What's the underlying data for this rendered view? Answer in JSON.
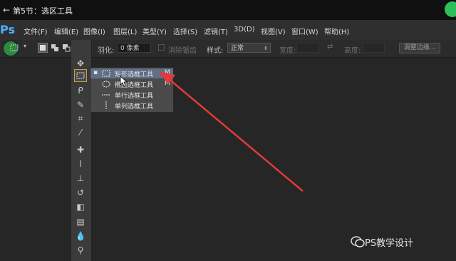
{
  "video": {
    "back_glyph": "←",
    "title": "第5节：选区工具"
  },
  "app": {
    "logo": "Ps"
  },
  "menu": [
    "文件(F)",
    "编辑(E)",
    "图像(I)",
    "图层(L)",
    "类型(Y)",
    "选择(S)",
    "滤镜(T)",
    "3D(D)",
    "视图(V)",
    "窗口(W)",
    "帮助(H)"
  ],
  "options_bar": {
    "feather_label": "羽化:",
    "feather_value": "0 像素",
    "antialias_label": "消除锯齿",
    "style_label": "样式:",
    "style_value": "正常",
    "width_label": "宽度:",
    "height_label": "高度:",
    "refine_edge_label": "调整边缘..."
  },
  "flyout": {
    "items": [
      {
        "label": "矩形选框工具",
        "shortcut": "M",
        "icon": "rect-marquee-icon",
        "selected": true
      },
      {
        "label": "椭圆选框工具",
        "shortcut": "M",
        "icon": "ellipse-marquee-icon",
        "selected": false
      },
      {
        "label": "单行选框工具",
        "shortcut": "",
        "icon": "single-row-marquee-icon",
        "selected": false
      },
      {
        "label": "单列选框工具",
        "shortcut": "",
        "icon": "single-column-marquee-icon",
        "selected": false
      }
    ]
  },
  "watermark": {
    "text": "PS教学设计"
  },
  "colors": {
    "accent_arrow": "#e23a3a",
    "highlight": "#5f6f86",
    "active_tool_border": "#c8a13a"
  }
}
